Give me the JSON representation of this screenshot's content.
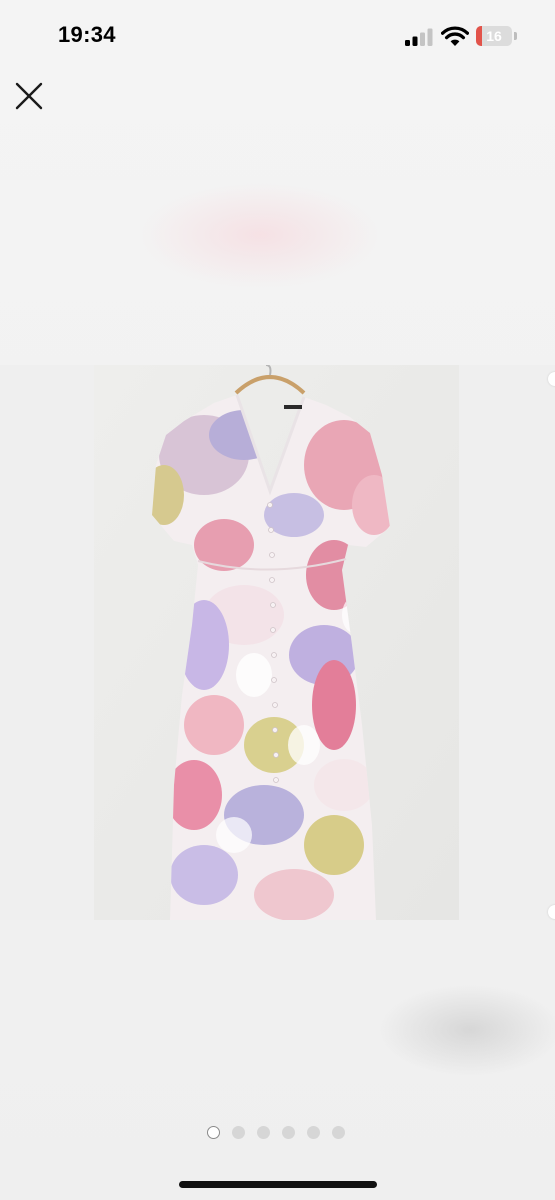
{
  "status_bar": {
    "time": "19:34",
    "battery_text": "16",
    "battery_level": 0.16,
    "icons": [
      "signal-icon",
      "wifi-icon",
      "battery-icon"
    ]
  },
  "toolbar": {
    "close_icon": "close-icon"
  },
  "gallery": {
    "image_subject": "floral-print-dress-on-hanger",
    "dots_count": 6,
    "active_dot": 1
  },
  "colors": {
    "background": "#f3f3f3",
    "battery_low": "#e2534a",
    "dot_inactive": "#d6d6d6",
    "home_indicator": "#111111"
  }
}
